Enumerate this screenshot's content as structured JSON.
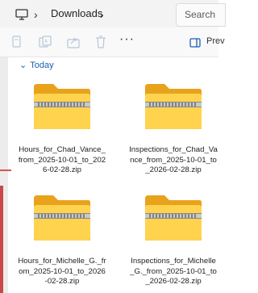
{
  "address_bar": {
    "breadcrumb": [
      "Downloads"
    ],
    "search_placeholder": "Search"
  },
  "toolbar": {
    "more_label": "···",
    "preview_label": "Prev"
  },
  "group": {
    "label": "Today"
  },
  "files": [
    {
      "name": "Hours_for_Chad_Vance_from_2025-10-01_to_2026-02-28.zip"
    },
    {
      "name": "Inspections_for_Chad_Vance_from_2025-10-01_to_2026-02-28.zip"
    },
    {
      "name": "Hours_for_Michelle_G._from_2025-10-01_to_2026-02-28.zip"
    },
    {
      "name": "Inspections_for_Michelle_G._from_2025-10-01_to_2026-02-28.zip"
    }
  ],
  "colors": {
    "folder_back": "#e8a21c",
    "folder_front": "#ffd34d",
    "zipper": "#7d7d7d",
    "accent": "#1a5fb4"
  }
}
